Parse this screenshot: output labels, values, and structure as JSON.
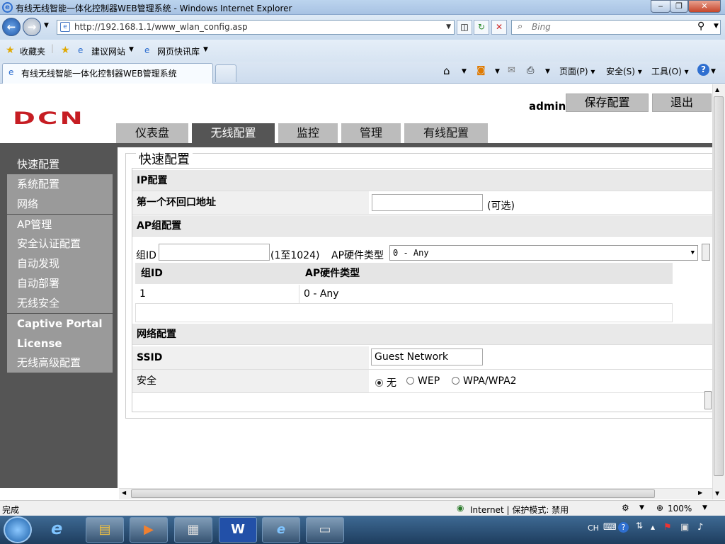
{
  "window": {
    "title": "有线无线智能一体化控制器WEB管理系统 - Windows Internet Explorer",
    "minimize": "‒",
    "maximize": "❐",
    "close": "✕"
  },
  "browser": {
    "url": "http://192.168.1.1/www_wlan_config.asp",
    "search_placeholder": "Bing",
    "favorites_label": "收藏夹",
    "fav_suggested": "建议网站",
    "fav_webslice": "网页快讯库",
    "tab_title": "有线无线智能一体化控制器WEB管理系统",
    "cmd_page": "页面(P)",
    "cmd_safety": "安全(S)",
    "cmd_tools": "工具(O)"
  },
  "header": {
    "logo": "DCN",
    "user": "admin",
    "save_config": "保存配置",
    "logout": "退出"
  },
  "nav_tabs": [
    "仪表盘",
    "无线配置",
    "监控",
    "管理",
    "有线配置"
  ],
  "sidebar": {
    "items": [
      "快速配置",
      "系统配置",
      "网络",
      "AP管理",
      "安全认证配置",
      "自动发现",
      "自动部署",
      "无线安全",
      "Captive Portal",
      "License",
      "无线高级配置"
    ]
  },
  "quick_config": {
    "legend": "快速配置",
    "ip_section": "IP配置",
    "loopback_label": "第一个环回口地址",
    "loopback_value": "",
    "optional": "(可选)",
    "ap_group_section": "AP组配置",
    "group_id_label": "组ID",
    "group_id_value": "",
    "group_id_range": "(1至1024)",
    "hw_type_label": "AP硬件类型",
    "hw_type_selected": "0 - Any",
    "table": {
      "headers": [
        "组ID",
        "AP硬件类型"
      ],
      "rows": [
        [
          "1",
          "0 - Any"
        ]
      ]
    },
    "network_section": "网络配置",
    "ssid_label": "SSID",
    "ssid_value": "Guest Network",
    "security_label": "安全",
    "security_options": [
      "无",
      "WEP",
      "WPA/WPA2"
    ],
    "security_selected": "无"
  },
  "status": {
    "left": "完成",
    "zone": "Internet | 保护模式: 禁用",
    "zoom": "100%"
  },
  "taskbar": {
    "lang": "CH"
  }
}
